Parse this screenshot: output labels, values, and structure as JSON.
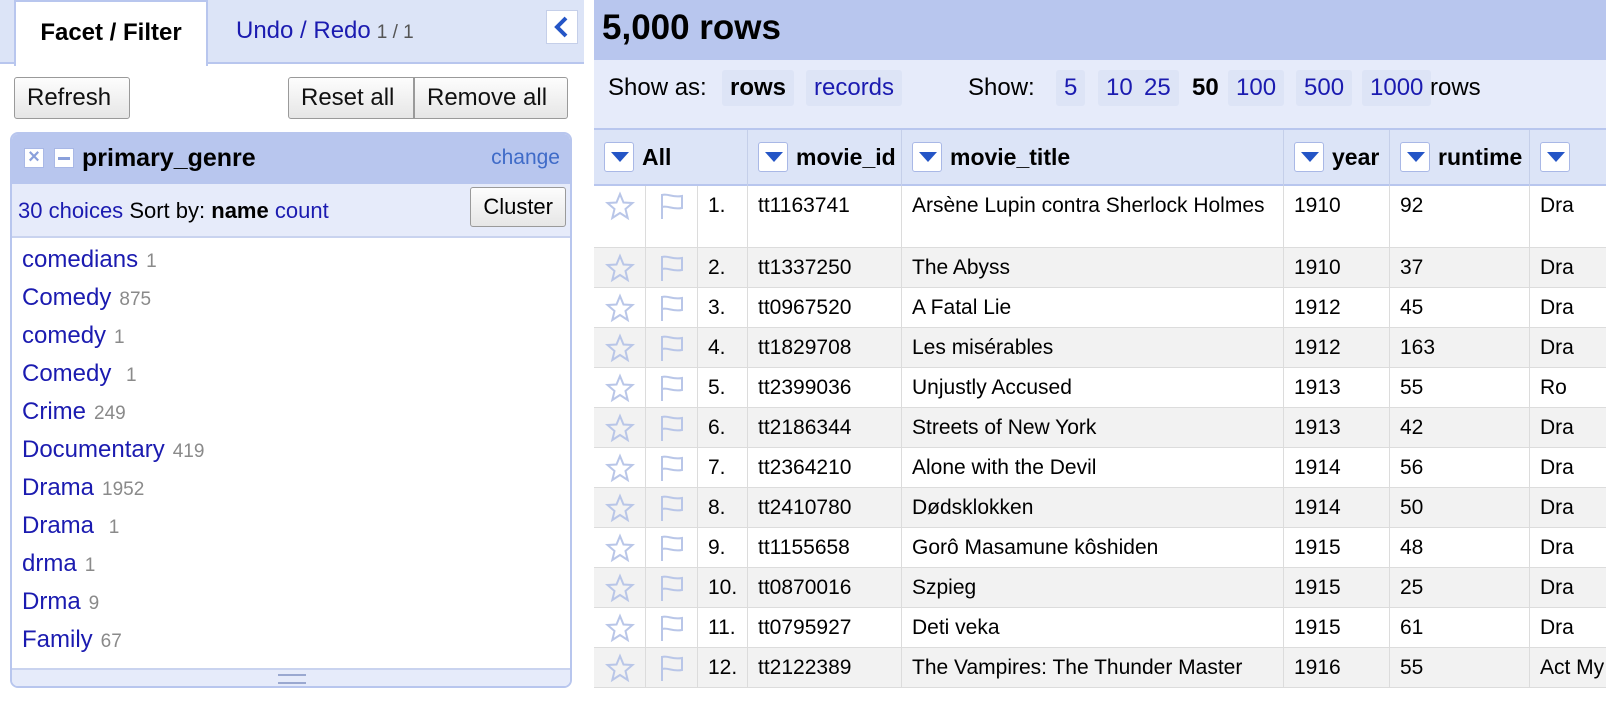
{
  "left_panel": {
    "tabs": {
      "facet_filter": "Facet / Filter",
      "undo_redo": "Undo / Redo",
      "undo_redo_count": "1 / 1"
    },
    "buttons": {
      "refresh": "Refresh",
      "reset_all": "Reset all",
      "remove_all": "Remove all"
    },
    "facet": {
      "title": "primary_genre",
      "change": "change",
      "choices_label": "30 choices",
      "sort_by_label": "Sort by:",
      "sort_name": "name",
      "sort_count": "count",
      "cluster": "Cluster",
      "items": [
        {
          "name": "comedians",
          "count": "1"
        },
        {
          "name": "Comedy",
          "count": "875"
        },
        {
          "name": "comedy",
          "count": "1"
        },
        {
          "name": "Comedy ",
          "count": "1"
        },
        {
          "name": "Crime",
          "count": "249"
        },
        {
          "name": "Documentary",
          "count": "419"
        },
        {
          "name": "Drama",
          "count": "1952"
        },
        {
          "name": "Drama ",
          "count": "1"
        },
        {
          "name": "drma",
          "count": "1"
        },
        {
          "name": "Drma",
          "count": "9"
        },
        {
          "name": "Family",
          "count": "67"
        }
      ]
    }
  },
  "right_panel": {
    "row_count": "5,000 rows",
    "toolbar": {
      "show_as_label": "Show as:",
      "show_as_rows": "rows",
      "show_as_records": "records",
      "show_label": "Show:",
      "page_sizes": [
        "5",
        "10",
        "25",
        "50",
        "100",
        "500",
        "1000"
      ],
      "selected_page_size": "50",
      "rows_suffix": "rows"
    },
    "table": {
      "columns": [
        "All",
        "movie_id",
        "movie_title",
        "year",
        "runtime",
        ""
      ],
      "rows": [
        {
          "index": "1.",
          "movie_id": "tt1163741",
          "movie_title": "Arsène Lupin contra Sherlock Holmes",
          "year": "1910",
          "runtime": "92",
          "genre": "Dra"
        },
        {
          "index": "2.",
          "movie_id": "tt1337250",
          "movie_title": "The Abyss",
          "year": "1910",
          "runtime": "37",
          "genre": "Dra"
        },
        {
          "index": "3.",
          "movie_id": "tt0967520",
          "movie_title": "A Fatal Lie",
          "year": "1912",
          "runtime": "45",
          "genre": "Dra"
        },
        {
          "index": "4.",
          "movie_id": "tt1829708",
          "movie_title": "Les misérables",
          "year": "1912",
          "runtime": "163",
          "genre": "Dra"
        },
        {
          "index": "5.",
          "movie_id": "tt2399036",
          "movie_title": "Unjustly Accused",
          "year": "1913",
          "runtime": "55",
          "genre": "Ro"
        },
        {
          "index": "6.",
          "movie_id": "tt2186344",
          "movie_title": "Streets of New York",
          "year": "1913",
          "runtime": "42",
          "genre": "Dra"
        },
        {
          "index": "7.",
          "movie_id": "tt2364210",
          "movie_title": "Alone with the Devil",
          "year": "1914",
          "runtime": "56",
          "genre": "Dra"
        },
        {
          "index": "8.",
          "movie_id": "tt2410780",
          "movie_title": "Dødsklokken",
          "year": "1914",
          "runtime": "50",
          "genre": "Dra"
        },
        {
          "index": "9.",
          "movie_id": "tt1155658",
          "movie_title": "Gorô Masamune kôshiden",
          "year": "1915",
          "runtime": "48",
          "genre": "Dra"
        },
        {
          "index": "10.",
          "movie_id": "tt0870016",
          "movie_title": "Szpieg",
          "year": "1915",
          "runtime": "25",
          "genre": "Dra"
        },
        {
          "index": "11.",
          "movie_id": "tt0795927",
          "movie_title": "Deti veka",
          "year": "1915",
          "runtime": "61",
          "genre": "Dra"
        },
        {
          "index": "12.",
          "movie_id": "tt2122389",
          "movie_title": "The Vampires: The Thunder Master",
          "year": "1916",
          "runtime": "55",
          "genre": "Act My"
        }
      ]
    }
  },
  "colors": {
    "accent": "#b8c6ee",
    "light_accent": "#e6ebfa",
    "link": "#1b1bb0"
  },
  "icons": [
    "chevron-left-icon",
    "close-icon",
    "minimize-icon",
    "dropdown-icon",
    "star-icon",
    "flag-icon"
  ]
}
